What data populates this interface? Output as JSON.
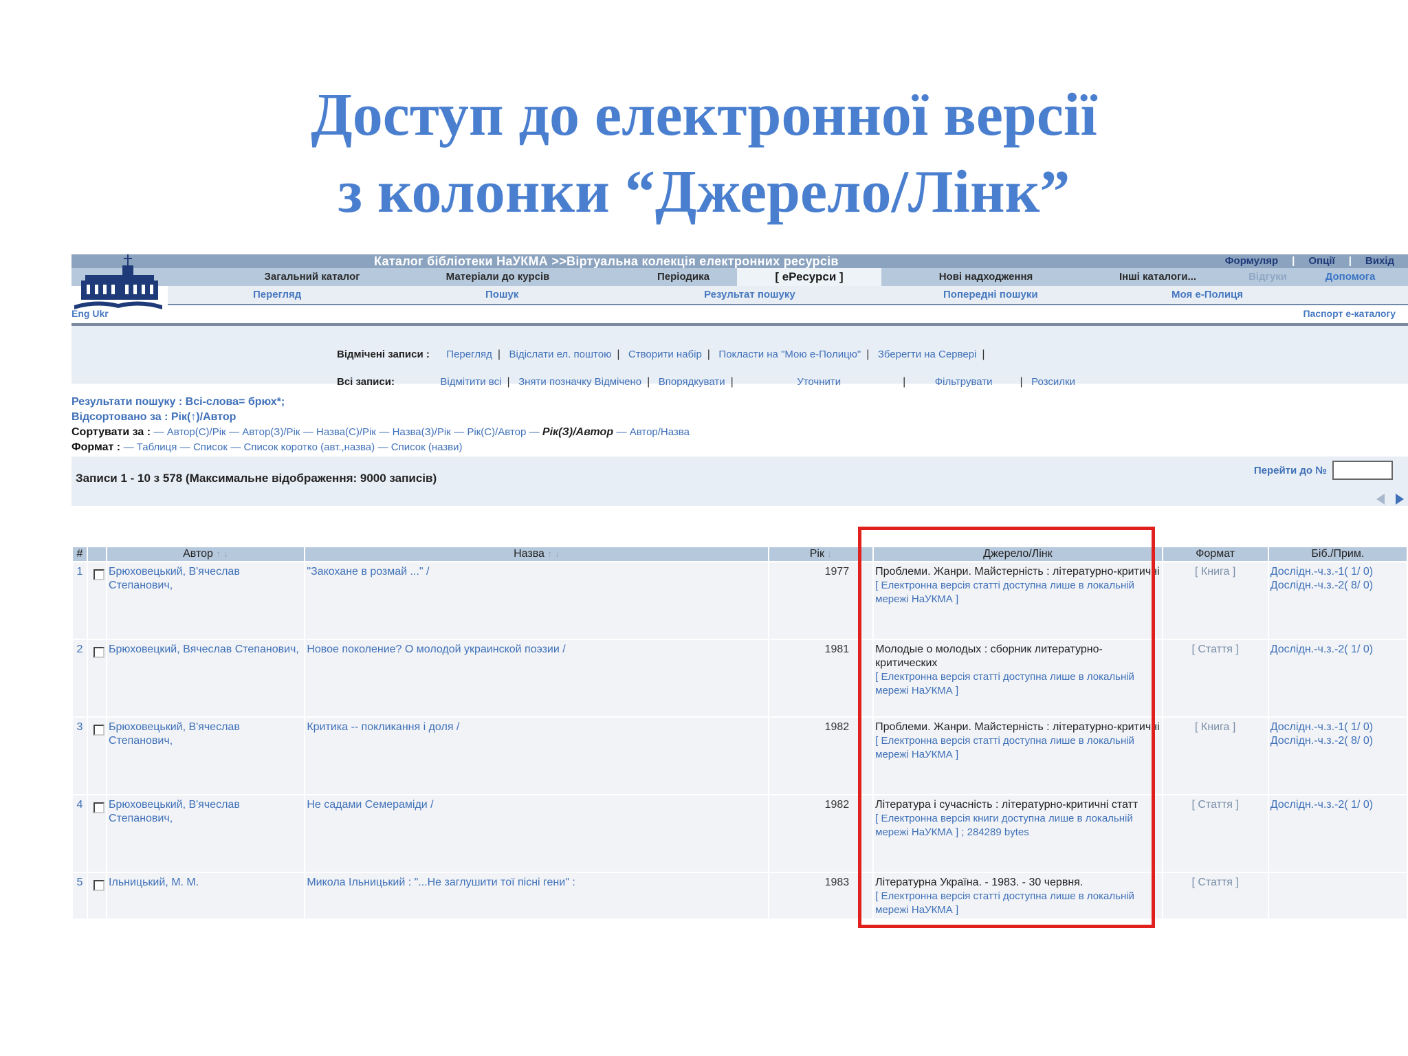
{
  "slide": {
    "title_line1": "Доступ до електронної версії",
    "title_line2": "з колонки “Джерело/Лінк”"
  },
  "header": {
    "catalog_title": "Каталог бібліотеки НаУКМА >>Віртуальна колекція електронних ресурсів",
    "top_links": [
      "Формуляр",
      "Опції",
      "Вихід"
    ],
    "tabs": [
      "Загальний каталог",
      "Матеріали до курсів",
      "Періодика",
      "[ еРесурси ]",
      "Нові надходження",
      "Інші каталоги...",
      "Відгуки",
      "Допомога"
    ],
    "subnav": [
      "Перегляд",
      "Пошук",
      "Результат пошуку",
      "Попередні пошуки",
      "Моя е-Полиця"
    ],
    "lang": "Eng Ukr",
    "passport": "Паспорт е-каталогу"
  },
  "actions": {
    "marked_label": "Відмічені записи :",
    "marked_links": [
      "Перегляд",
      "Відіслати ел. поштою",
      "Створити набір",
      "Покласти на \"Мою е-Полицю\"",
      "Зберегти на Сервері"
    ],
    "all_label": "Всі записи:",
    "all_links": [
      "Відмітити всі",
      "Зняти позначку Відмічено",
      "Впорядкувати",
      "Уточнити",
      "Фільтрувати",
      "Розсилки"
    ]
  },
  "results": {
    "query": "Результати пошуку : Всі-слова= брюх*;",
    "sorted": "Відсортовано за : Рік(↑)/Автор",
    "sort_label": "Сортувати за :",
    "sort_options": [
      "Автор(С)/Рік",
      "Автор(З)/Рік",
      "Назва(С)/Рік",
      "Назва(З)/Рік",
      "Рік(С)/Автор",
      "Рік(З)/Автор",
      "Автор/Назва"
    ],
    "format_label": "Формат :",
    "format_options": [
      "Таблиця",
      "Список",
      "Список коротко (авт.,назва)",
      "Список (назви)"
    ],
    "count": "Записи 1 - 10 з 578 (Максимальне відображення: 9000 записів)",
    "goto": "Перейти до №"
  },
  "table": {
    "headers": {
      "num": "#",
      "author": "Автор",
      "title": "Назва",
      "year": "Рік",
      "source": "Джерело/Лінк",
      "format": "Формат",
      "bib": "Біб./Прим."
    },
    "rows": [
      {
        "num": "1",
        "author": "Брюховецький, В'ячеслав Степанович,",
        "title": "\"Закохане в розмай ...\" /",
        "year": "1977",
        "source": "Проблеми. Жанри. Майстерність : літературно-критичні",
        "note": "[ Електронна версія статті доступна лише в локальній мережі НаУКМА ]",
        "format": "[ Книга ]",
        "bib1": "Дослідн.-ч.з.-1( 1/ 0)",
        "bib2": "Дослідн.-ч.з.-2( 8/ 0)"
      },
      {
        "num": "2",
        "author": "Брюховецкий, Вячеслав Степанович,",
        "title": "Новое поколение? О молодой украинской поэзии /",
        "year": "1981",
        "source": "Молодые о молодых : сборник литературно-критических",
        "note": "[ Електронна версія статті доступна лише в локальній мережі НаУКМА ]",
        "format": "[ Стаття ]",
        "bib1": "Дослідн.-ч.з.-2( 1/ 0)",
        "bib2": ""
      },
      {
        "num": "3",
        "author": "Брюховецький, В'ячеслав Степанович,",
        "title": "Критика -- покликання і доля /",
        "year": "1982",
        "source": "Проблеми. Жанри. Майстерність : літературно-критичні",
        "note": "[ Електронна версія статті доступна лише в локальній мережі НаУКМА ]",
        "format": "[ Книга ]",
        "bib1": "Дослідн.-ч.з.-1( 1/ 0)",
        "bib2": "Дослідн.-ч.з.-2( 8/ 0)"
      },
      {
        "num": "4",
        "author": "Брюховецький, В'ячеслав Степанович,",
        "title": "Не садами Семераміди /",
        "year": "1982",
        "source": "Література і сучасність : літературно-критичні статт",
        "note": "[ Електронна версія книги доступна лише в локальній мережі НаУКМА ] ; 284289 bytes",
        "format": "[ Стаття ]",
        "bib1": "Дослідн.-ч.з.-2( 1/ 0)",
        "bib2": ""
      },
      {
        "num": "5",
        "author": "Ільницький, М. М.",
        "title": "Микола Ільницький : \"...Не заглушити тої пісні гени\" :",
        "year": "1983",
        "source": "Літературна Україна. - 1983. - 30 червня.",
        "note": "[ Електронна версія статті доступна лише в локальній мережі НаУКМА ]",
        "format": "[ Стаття ]",
        "bib1": "",
        "bib2": ""
      }
    ]
  },
  "colors": {
    "title_blue": "#4a7fcf",
    "highlight_red": "#e0201c",
    "link_blue": "#3f70b8"
  }
}
